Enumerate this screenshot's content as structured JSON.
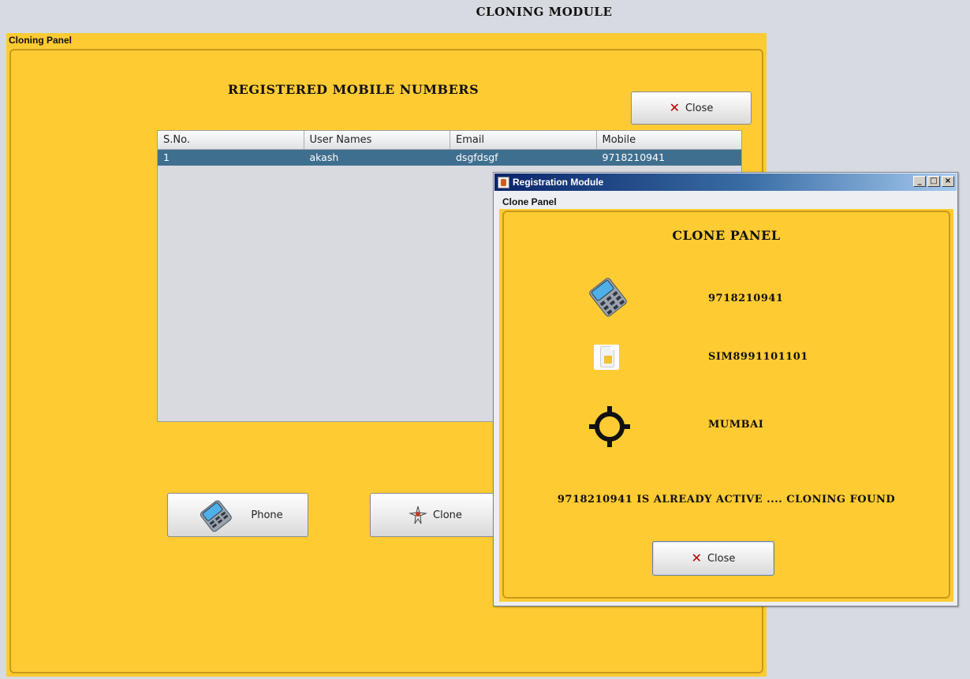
{
  "page": {
    "title": "CLONING MODULE"
  },
  "cloning_panel": {
    "caption": "Cloning Panel",
    "heading": "REGISTERED MOBILE NUMBERS",
    "close_label": "Close",
    "table": {
      "columns": [
        "S.No.",
        "User Names",
        "Email",
        "Mobile"
      ],
      "rows": [
        [
          "1",
          "akash",
          "dsgfdsgf",
          "9718210941"
        ]
      ]
    },
    "phone_label": "Phone",
    "clone_label": "Clone"
  },
  "popup": {
    "window_title": "Registration Module",
    "caption": "Clone Panel",
    "heading": "CLONE PANEL",
    "mobile": "9718210941",
    "sim": "SIM8991101101",
    "location": "MUMBAI",
    "status": "9718210941 IS ALREADY ACTIVE .... CLONING FOUND",
    "close_label": "Close",
    "controls": {
      "minimize": "_",
      "maximize": "□",
      "close": "×"
    }
  },
  "colors": {
    "panel": "#ffcb33",
    "selection": "#3f6f8f",
    "close_x": "#b30000"
  },
  "icons": [
    "phone-icon",
    "clone-icon",
    "close-x-icon",
    "sim-card-icon",
    "location-target-icon",
    "java-app-icon"
  ]
}
